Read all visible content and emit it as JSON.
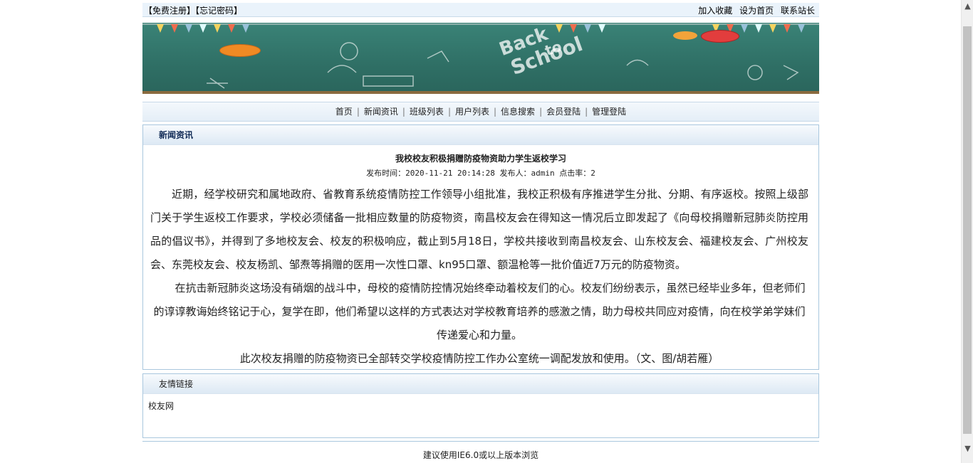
{
  "topbar": {
    "register": "【免费注册】",
    "forgot": "【忘记密码】",
    "favorite": "加入收藏",
    "homepage": "设为首页",
    "contact": "联系站长"
  },
  "banner": {
    "text1": "Back",
    "text2": "to",
    "text3": "School"
  },
  "nav": {
    "items": [
      "首页",
      "新闻资讯",
      "班级列表",
      "用户列表",
      "信息搜索",
      "会员登陆",
      "管理登陆"
    ]
  },
  "news": {
    "header": "新闻资讯",
    "title": "我校校友积极捐赠防疫物资助力学生返校学习",
    "meta": "发布时间：2020-11-21 20:14:28 发布人：admin 点击率：2",
    "para1": "近期，经学校研究和属地政府、省教育系统疫情防控工作领导小组批准，我校正积极有序推进学生分批、分期、有序返校。按照上级部门关于学生返校工作要求，学校必须储备一批相应数量的防疫物资，南昌校友会在得知这一情况后立即发起了《向母校捐赠新冠肺炎防控用品的倡议书》，并得到了多地校友会、校友的积极响应，截止到5月18日，学校共接收到南昌校友会、山东校友会、福建校友会、广州校友会、东莞校友会、校友杨凯、邹焘等捐赠的医用一次性口罩、kn95口罩、额温枪等一批价值近7万元的防疫物资。",
    "para2": "在抗击新冠肺炎这场没有硝烟的战斗中，母校的疫情防控情况始终牵动着校友们的心。校友们纷纷表示，虽然已经毕业多年，但老师们的谆谆教诲始终铭记于心，复学在即，他们希望以这样的方式表达对学校教育培养的感激之情，助力母校共同应对疫情，向在校学弟学妹们传递爱心和力量。",
    "para3": "此次校友捐赠的防疫物资已全部转交学校疫情防控工作办公室统一调配发放和使用。（文、图/胡若雁）"
  },
  "links": {
    "header": "友情链接",
    "items": [
      "校友网"
    ]
  },
  "footer": {
    "text": "建议使用IE6.0或以上版本浏览"
  },
  "colors": {
    "banner_green": "#2f6f65",
    "header_navy": "#102a55",
    "border_blue": "#a9c7de"
  }
}
